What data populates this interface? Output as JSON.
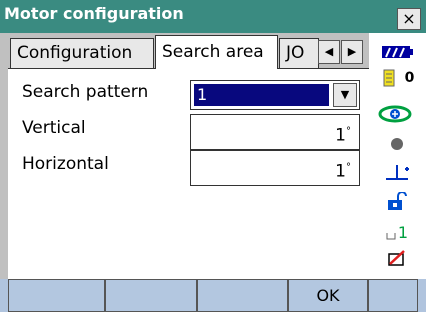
{
  "window": {
    "title": "Motor configuration",
    "close_glyph": "×"
  },
  "tabs": [
    {
      "label": "Configuration",
      "active": false
    },
    {
      "label": "Search area",
      "active": true
    },
    {
      "label": "JO",
      "active": false
    }
  ],
  "tab_scroll": {
    "left_glyph": "◀",
    "right_glyph": "▶"
  },
  "fields": {
    "search_pattern": {
      "label": "Search pattern",
      "value": "1",
      "dropdown_glyph": "▼"
    },
    "vertical": {
      "label": "Vertical",
      "value": "1",
      "unit": "°"
    },
    "horizontal": {
      "label": "Horizontal",
      "value": "1",
      "unit": "°"
    }
  },
  "status_icons": {
    "battery": "battery-icon",
    "tilt_value": "0",
    "count": "1"
  },
  "softkeys": [
    {
      "label": ""
    },
    {
      "label": ""
    },
    {
      "label": ""
    },
    {
      "label": "OK"
    },
    {
      "label": ""
    }
  ],
  "colors": {
    "titlebar": "#3a8b81",
    "selection": "#08087e",
    "softkey": "#b3c7e0"
  }
}
